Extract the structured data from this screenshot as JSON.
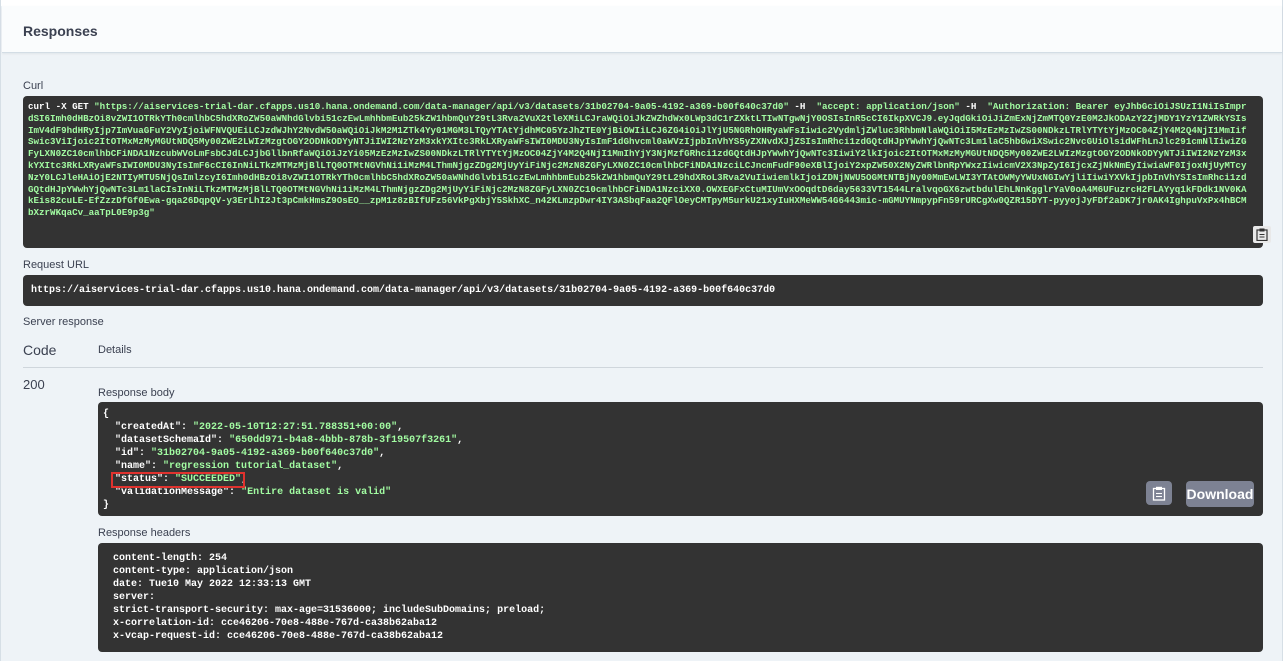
{
  "section": {
    "title": "Responses",
    "curl_label": "Curl",
    "request_url_label": "Request URL",
    "server_response_label": "Server response",
    "code_header": "Code",
    "details_header": "Details",
    "response_body_label": "Response body",
    "response_headers_label": "Response headers"
  },
  "curl": {
    "prefix": "curl -X GET ",
    "url": "\"https://aiservices-trial-dar.cfapps.us10.hana.ondemand.com/data-manager/api/v3/datasets/31b02704-9a05-4192-a369-b00f640c37d0\"",
    "h1_flag": " -H  ",
    "h1": "\"accept: application/json\"",
    "h2_flag": " -H  ",
    "h2": "\"Authorization: Bearer eyJhbGciOiJSUzI1NiIsImprdSI6Imh0dHBzOi8vZWI1OTRkYTh0cmlhbC5hdXRoZW50aWNhdGlvbi51czEwLmhhbmEub25kZW1hbmQuY29tL3Rva2VuX2tleXMiLCJraWQiOiJkZWZhdWx0LWp3dC1rZXktLTIwNTgwNjY0OSIsInR5cCI6IkpXVCJ9.eyJqdGkiOiJiZmExNjZmMTQ0YzE0M2JkODAzY2ZjMDY1YzY1ZWRkYSIsImV4dF9hdHRyIjp7ImVuaGFuY2VyIjoiWFNVQUEiLCJzdWJhY2NvdW50aWQiOiJkM2M1ZTk4Yy01MGM3LTQyYTAtYjdhMC05YzJhZTE0YjBiOWIiLCJ6ZG4iOiJlYjU5NGRhOHRyaWFsIiwic2VydmljZWluc3RhbmNlaWQiOiI5MzEzMzIwZS00NDkzLTRlYTYtYjMzOC04ZjY4M2Q4NjI1MmIifSwic3ViIjoic2ItOTMxMzMyMGUtNDQ5My00ZWE2LWIzMzgtOGY2ODNkODYyNTJiIWI2NzYzM3xkYXItc3RkLXRyaWFsIWI0MDU3NyIsImF1dGhvcml0aWVzIjpbInVhYS5yZXNvdXJjZSIsImRhci1zdGQtdHJpYWwhYjQwNTc3Lm1laC5hbGwiXSwic2NvcGUiOlsidWFhLnJlc291cmNlIiwiZGFyLXN0ZC10cmlhbCFiNDA1NzcubWVoLmFsbCJdLCJjbGllbnRfaWQiOiJzYi05MzEzMzIwZS00NDkzLTRlYTYtYjMzOC04ZjY4M2Q4NjI1MmIhYjY3NjMzfGRhci1zdGQtdHJpYWwhYjQwNTc3IiwiY2lkIjoic2ItOTMxMzMyMGUtNDQ5My00ZWE2LWIzMzgtOGY2ODNkODYyNTJiIWI2NzYzM3xkYXItc3RkLXRyaWFsIWI0MDU3NyIsImF6cCI6InNiLTkzMTMzMjBlLTQ0OTMtNGVhNi1iMzM4LThmNjgzZDg2MjUyYiFiNjc2MzN8ZGFyLXN0ZC10cmlhbCFiNDA1NzciLCJncmFudF90eXBlIjoiY2xpZW50X2NyZWRlbnRpYWxzIiwicmV2X3NpZyI6IjcxZjNkNmEyIiwiaWF0IjoxNjUyMTcyNzY0LCJleHAiOjE2NTIyMTU5NjQsImlzcyI6Imh0dHBzOi8vZWI1OTRkYTh0cmlhbC5hdXRoZW50aWNhdGlvbi51czEwLmhhbmEub25kZW1hbmQuY29tL29hdXRoL3Rva2VuIiwiemlkIjoiZDNjNWU5OGMtNTBjNy00MmEwLWI3YTAtOWMyYWUxNGIwYjliIiwiYXVkIjpbInVhYSIsImRhci1zdGQtdHJpYWwhYjQwNTc3Lm1laCIsInNiLTkzMTMzMjBlLTQ0OTMtNGVhNi1iMzM4LThmNjgzZDg2MjUyYiFiNjc2MzN8ZGFyLXN0ZC10cmlhbCFiNDA1NzciXX0.OWXEGFxCtuMIUmVxOOqdtD6day5633VT1544LralvqoGX6zwtbdulEhLNnKgglrYaV0oA4M6UFuzrcH2FLAYyq1kFDdk1NV0KAkEis82cuLE-EfZzzDfGf0Ewa-gqa26DqpQV-y3ErLhI2Jt3pCmkHmsZ9OsEO__zpM1z8zBIfUFz56VkPgXbjY5SkhXC_n42KLmzpDwr4IY3ASbqFaa2QFlOeyCMTpyM5urkU21xyIuHXMeWW54G6443mic-mGMUYNmpypFn59rURCgXw0QZR15DYT-pyyojJyFDf2aDK7jr0AK4IghpuVxPx4hBCMbXzrWKqaCv_aaTpL0E9p3g\"",
    "copy_icon": "clipboard-icon"
  },
  "request_url": "https://aiservices-trial-dar.cfapps.us10.hana.ondemand.com/data-manager/api/v3/datasets/31b02704-9a05-4192-a369-b00f640c37d0",
  "response": {
    "code": "200",
    "body": {
      "open": "{",
      "close": "}",
      "rows": [
        {
          "key": "\"createdAt\"",
          "value": "\"2022-05-10T12:27:51.788351+00:00\"",
          "comma": ","
        },
        {
          "key": "\"datasetSchemaId\"",
          "value": "\"650dd971-b4a8-4bbb-878b-3f19507f3261\"",
          "comma": ","
        },
        {
          "key": "\"id\"",
          "value": "\"31b02704-9a05-4192-a369-b00f640c37d0\"",
          "comma": ","
        },
        {
          "key": "\"name\"",
          "value": "\"regression tutorial_dataset\"",
          "comma": ","
        },
        {
          "key": "\"status\"",
          "value": "\"SUCCEEDED\"",
          "comma": ","
        },
        {
          "key": "\"validationMessage\"",
          "value": "\"Entire dataset is valid\"",
          "comma": ""
        }
      ]
    },
    "download_label": "Download",
    "copy_icon": "clipboard-icon",
    "headers": [
      "content-length: 254",
      "content-type: application/json",
      "date: Tue10 May 2022 12:33:13 GMT",
      "server:",
      "strict-transport-security: max-age=31536000; includeSubDomains; preload;",
      "x-correlation-id: cce46206-70e8-488e-767d-ca38b62aba12",
      "x-vcap-request-id: cce46206-70e8-488e-767d-ca38b62aba12"
    ]
  },
  "colors": {
    "code_bg": "#333333",
    "string_green": "#a2fca2",
    "button_gray": "#7d8293",
    "highlight_red": "#e0322e"
  }
}
